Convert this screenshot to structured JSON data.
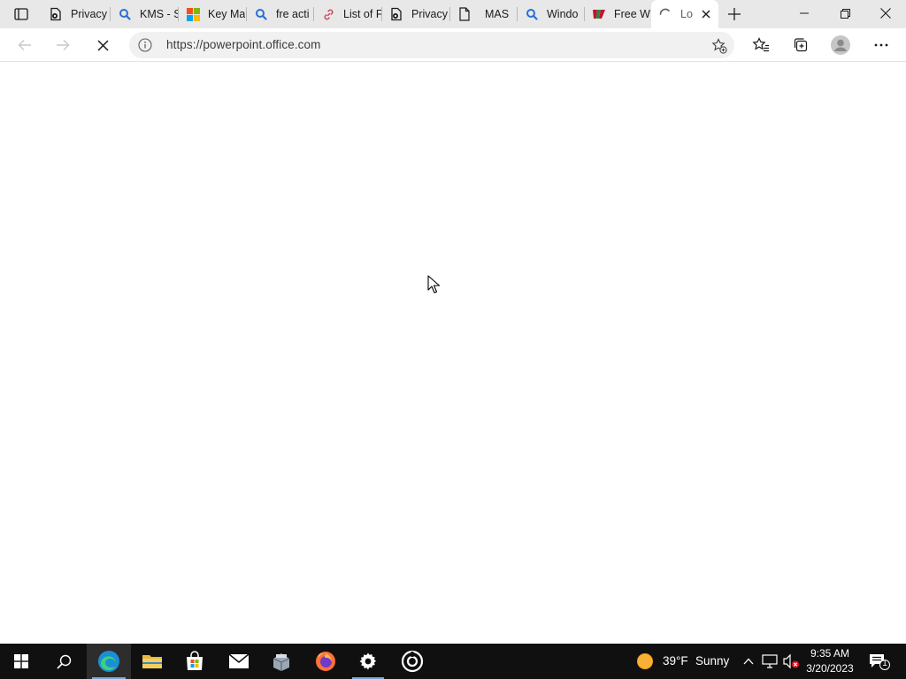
{
  "browser": {
    "tabs": [
      {
        "title": "Privacy",
        "favicon": "privacy-policy-icon"
      },
      {
        "title": "KMS - S",
        "favicon": "bing-search-icon"
      },
      {
        "title": "Key Ma",
        "favicon": "microsoft-logo-icon"
      },
      {
        "title": "fre acti",
        "favicon": "bing-search-icon"
      },
      {
        "title": "List of F",
        "favicon": "link-icon"
      },
      {
        "title": "Privacy",
        "favicon": "privacy-policy-icon"
      },
      {
        "title": "MAS",
        "favicon": "document-icon"
      },
      {
        "title": "Windo",
        "favicon": "bing-search-icon"
      },
      {
        "title": "Free W",
        "favicon": "red-site-icon"
      },
      {
        "title": "Lo",
        "favicon": "loading-spinner-icon",
        "active": true
      }
    ],
    "address_url": "https://powerpoint.office.com",
    "accent_color": "#0078d4"
  },
  "taskbar": {
    "pinned": [
      {
        "name": "start",
        "icon": "windows-logo-icon"
      },
      {
        "name": "search",
        "icon": "search-icon"
      },
      {
        "name": "edge",
        "icon": "edge-icon"
      },
      {
        "name": "file-explorer",
        "icon": "folder-icon"
      },
      {
        "name": "store",
        "icon": "store-icon"
      },
      {
        "name": "mail",
        "icon": "mail-icon"
      },
      {
        "name": "app",
        "icon": "app-icon"
      },
      {
        "name": "firefox",
        "icon": "firefox-icon"
      },
      {
        "name": "settings",
        "icon": "gear-icon"
      },
      {
        "name": "media",
        "icon": "media-icon"
      }
    ],
    "weather": {
      "temp": "39°F",
      "condition": "Sunny"
    },
    "clock": {
      "time": "9:35 AM",
      "date": "3/20/2023"
    },
    "notification_count": "1"
  }
}
